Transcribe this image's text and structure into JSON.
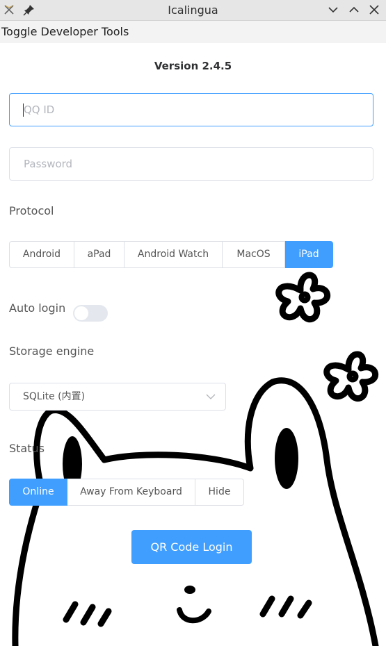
{
  "window": {
    "title": "Icalingua",
    "app_icon": "icalingua-app-icon",
    "pin_icon": "pin-icon"
  },
  "menubar": {
    "items": [
      {
        "label": "Toggle Developer Tools"
      }
    ]
  },
  "login": {
    "version": "Version 2.4.5",
    "qq_id": {
      "placeholder": "QQ ID",
      "value": ""
    },
    "password": {
      "placeholder": "Password",
      "value": ""
    },
    "protocol": {
      "label": "Protocol",
      "options": [
        "Android",
        "aPad",
        "Android Watch",
        "MacOS",
        "iPad"
      ],
      "selected": "iPad"
    },
    "auto_login": {
      "label": "Auto login",
      "enabled": false
    },
    "storage_engine": {
      "label": "Storage engine",
      "selected": "SQLite (内置)"
    },
    "status": {
      "label": "Status",
      "options": [
        "Online",
        "Away From Keyboard",
        "Hide"
      ],
      "selected": "Online"
    },
    "qr_login_button": "QR Code Login"
  },
  "colors": {
    "accent": "#409eff",
    "border": "#dcdfe6",
    "titlebar": "#e6e6e6"
  }
}
